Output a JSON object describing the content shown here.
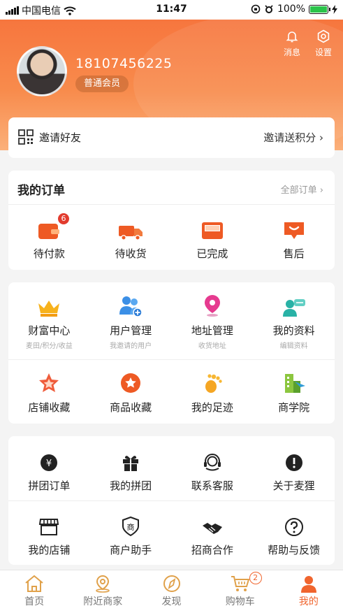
{
  "status_bar": {
    "carrier": "中国电信",
    "time": "11:47",
    "battery": "100%",
    "battery_level": 1.0
  },
  "header": {
    "messages_label": "消息",
    "settings_label": "设置",
    "phone": "18107456225",
    "member_level": "普通会员"
  },
  "invite": {
    "label": "邀请好友",
    "reward": "邀请送积分 ›"
  },
  "orders": {
    "title": "我的订单",
    "all_label": "全部订单 ›",
    "items": [
      {
        "label": "待付款",
        "icon": "wallet-icon",
        "badge": "6"
      },
      {
        "label": "待收货",
        "icon": "truck-icon"
      },
      {
        "label": "已完成",
        "icon": "box-icon"
      },
      {
        "label": "售后",
        "icon": "service-bag-icon"
      }
    ]
  },
  "tools": {
    "row1": [
      {
        "label": "财富中心",
        "sub": "麦田/积分/收益",
        "icon": "crown-icon"
      },
      {
        "label": "用户管理",
        "sub": "我邀请的用户",
        "icon": "users-add-icon"
      },
      {
        "label": "地址管理",
        "sub": "收货地址",
        "icon": "location-pin-icon"
      },
      {
        "label": "我的资料",
        "sub": "编辑资料",
        "icon": "profile-chat-icon"
      }
    ],
    "row2": [
      {
        "label": "店铺收藏",
        "icon": "star-badge-icon"
      },
      {
        "label": "商品收藏",
        "icon": "star-circle-icon"
      },
      {
        "label": "我的足迹",
        "icon": "footprint-icon"
      },
      {
        "label": "商学院",
        "icon": "building-icon"
      }
    ]
  },
  "services": {
    "row1": [
      {
        "label": "拼团订单",
        "icon": "yen-circle-icon"
      },
      {
        "label": "我的拼团",
        "icon": "gift-icon"
      },
      {
        "label": "联系客服",
        "icon": "headset-icon"
      },
      {
        "label": "关于麦狸",
        "icon": "info-circle-icon"
      }
    ],
    "row2": [
      {
        "label": "我的店铺",
        "icon": "store-icon"
      },
      {
        "label": "商户助手",
        "icon": "merchant-shield-icon"
      },
      {
        "label": "招商合作",
        "icon": "handshake-icon"
      },
      {
        "label": "帮助与反馈",
        "icon": "help-circle-icon"
      }
    ]
  },
  "tabbar": [
    {
      "label": "首页",
      "icon": "home-icon"
    },
    {
      "label": "附近商家",
      "icon": "nearby-pin-icon"
    },
    {
      "label": "发现",
      "icon": "compass-icon"
    },
    {
      "label": "购物车",
      "icon": "cart-icon",
      "badge": "2"
    },
    {
      "label": "我的",
      "icon": "person-icon",
      "active": true
    }
  ],
  "colors": {
    "accent": "#f0652e",
    "header_gradient_top": "#f6703a",
    "header_gradient_bottom": "#fbb07a",
    "badge_red": "#e23b2e"
  }
}
